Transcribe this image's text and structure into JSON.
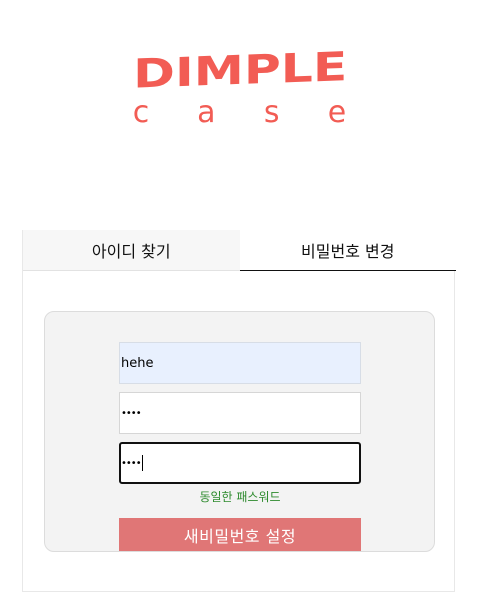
{
  "logo": {
    "top_text": "DIMPLE",
    "bottom_letters": [
      "c",
      "a",
      "s",
      "e"
    ],
    "brand_color": "#f25c54"
  },
  "tabs": [
    {
      "label": "아이디 찾기",
      "active": false
    },
    {
      "label": "비밀번호 변경",
      "active": true
    }
  ],
  "form": {
    "username_value": "hehe",
    "new_password_value": "••••",
    "confirm_password_value": "••••",
    "match_message": "동일한 패스워드",
    "submit_label": "새비밀번호 설정",
    "submit_color": "#e07676",
    "match_color": "#2e8b2e"
  }
}
